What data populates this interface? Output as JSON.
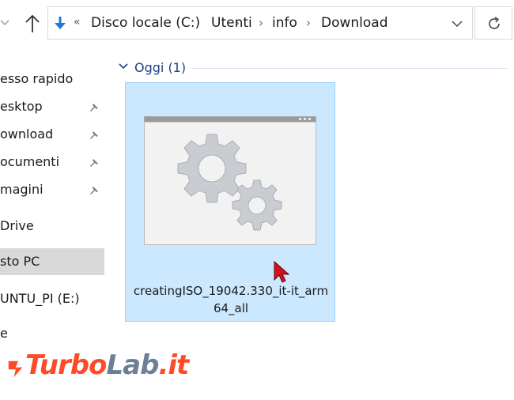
{
  "addressbar": {
    "crumbs": [
      "Disco locale (C:)",
      "Utenti",
      "info",
      "Download"
    ]
  },
  "sidebar": {
    "items": [
      {
        "label": "esso rapido",
        "pinned": false,
        "selected": false
      },
      {
        "label": "esktop",
        "pinned": true,
        "selected": false
      },
      {
        "label": "ownload",
        "pinned": true,
        "selected": false
      },
      {
        "label": "ocumenti",
        "pinned": true,
        "selected": false
      },
      {
        "label": "magini",
        "pinned": true,
        "selected": false
      },
      {
        "label": "Drive",
        "pinned": false,
        "selected": false
      },
      {
        "label": "sto PC",
        "pinned": false,
        "selected": true
      },
      {
        "label": "UNTU_PI (E:)",
        "pinned": false,
        "selected": false
      }
    ],
    "stub": "e"
  },
  "main": {
    "group": {
      "label": "Oggi (1)"
    },
    "file": {
      "name_line1": "creatingISO_19042.330_it-it_arm",
      "name_line2": "64_all"
    }
  },
  "watermark": {
    "part1": "Turbo",
    "part2": "Lab",
    "part3": ".it"
  },
  "colors": {
    "selection_bg": "#cce8ff",
    "selection_border": "#99d1ff",
    "group_label": "#1e3f8a",
    "sidebar_selected": "#d9d9d9"
  }
}
